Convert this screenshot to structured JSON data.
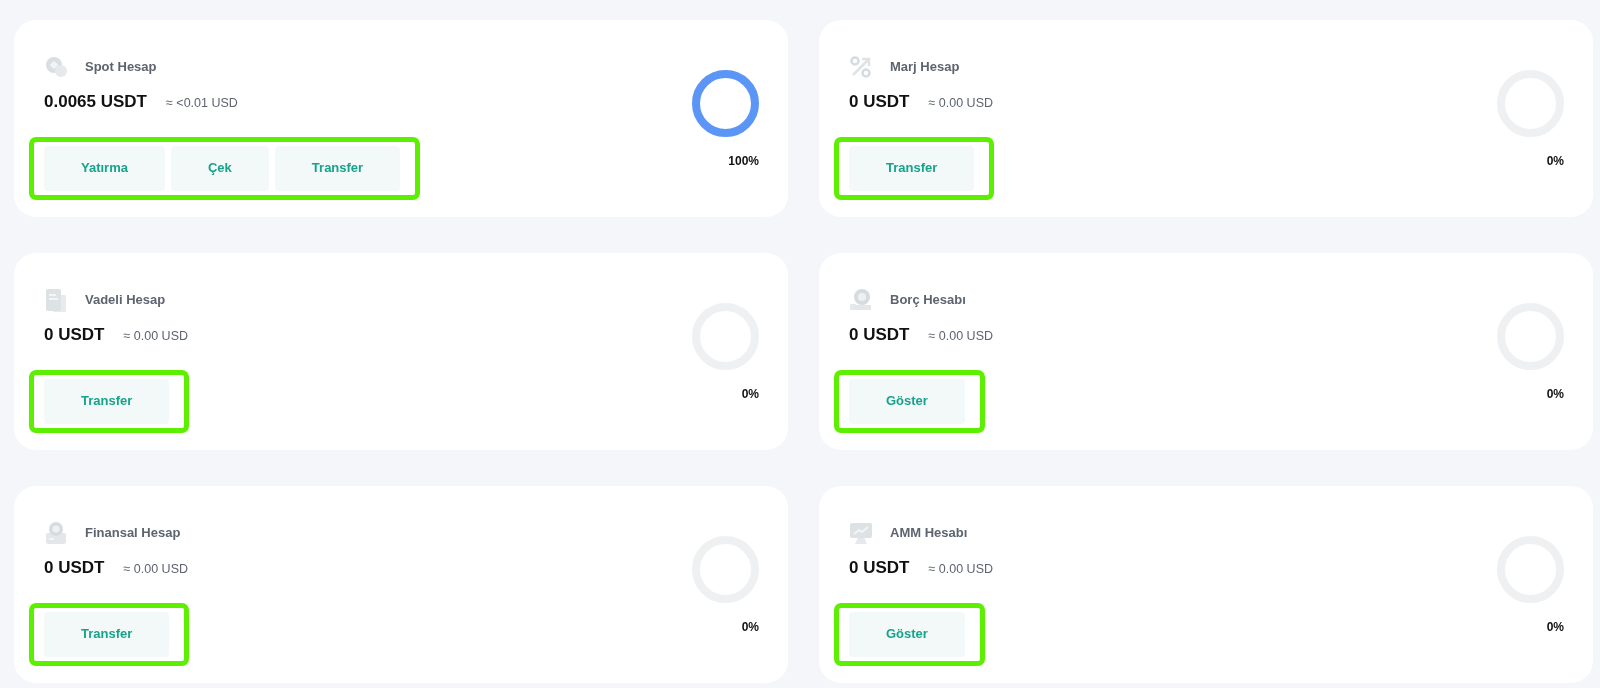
{
  "accounts": [
    {
      "title": "Spot Hesap",
      "amount": "0.0065 USDT",
      "approx": "≈ <0.01 USD",
      "share": {
        "level": 1,
        "reading": "100%"
      },
      "actions_highlighted": true,
      "actions": [
        "Yatırma",
        "Çek",
        "Transfer"
      ]
    },
    {
      "title": "Marj Hesap",
      "amount": "0 USDT",
      "approx": "≈ 0.00 USD",
      "share": {
        "level": 0,
        "reading": "0%"
      },
      "actions_highlighted": true,
      "actions": [
        "Transfer"
      ]
    },
    {
      "title": "Vadeli Hesap",
      "amount": "0 USDT",
      "approx": "≈ 0.00 USD",
      "share": {
        "level": 0,
        "reading": "0%"
      },
      "actions_highlighted": true,
      "actions": [
        "Transfer"
      ]
    },
    {
      "title": "Borç Hesabı",
      "amount": "0 USDT",
      "approx": "≈ 0.00 USD",
      "share": {
        "level": 0,
        "reading": "0%"
      },
      "actions_highlighted": true,
      "actions": [
        "Göster"
      ]
    },
    {
      "title": "Finansal Hesap",
      "amount": "0 USDT",
      "approx": "≈ 0.00 USD",
      "share": {
        "level": 0,
        "reading": "0%"
      },
      "actions_highlighted": true,
      "actions": [
        "Transfer"
      ]
    },
    {
      "title": "AMM Hesabı",
      "amount": "0 USDT",
      "approx": "≈ 0.00 USD",
      "share": {
        "level": 0,
        "reading": "0%"
      },
      "actions_highlighted": true,
      "actions": [
        "Göster"
      ]
    }
  ]
}
